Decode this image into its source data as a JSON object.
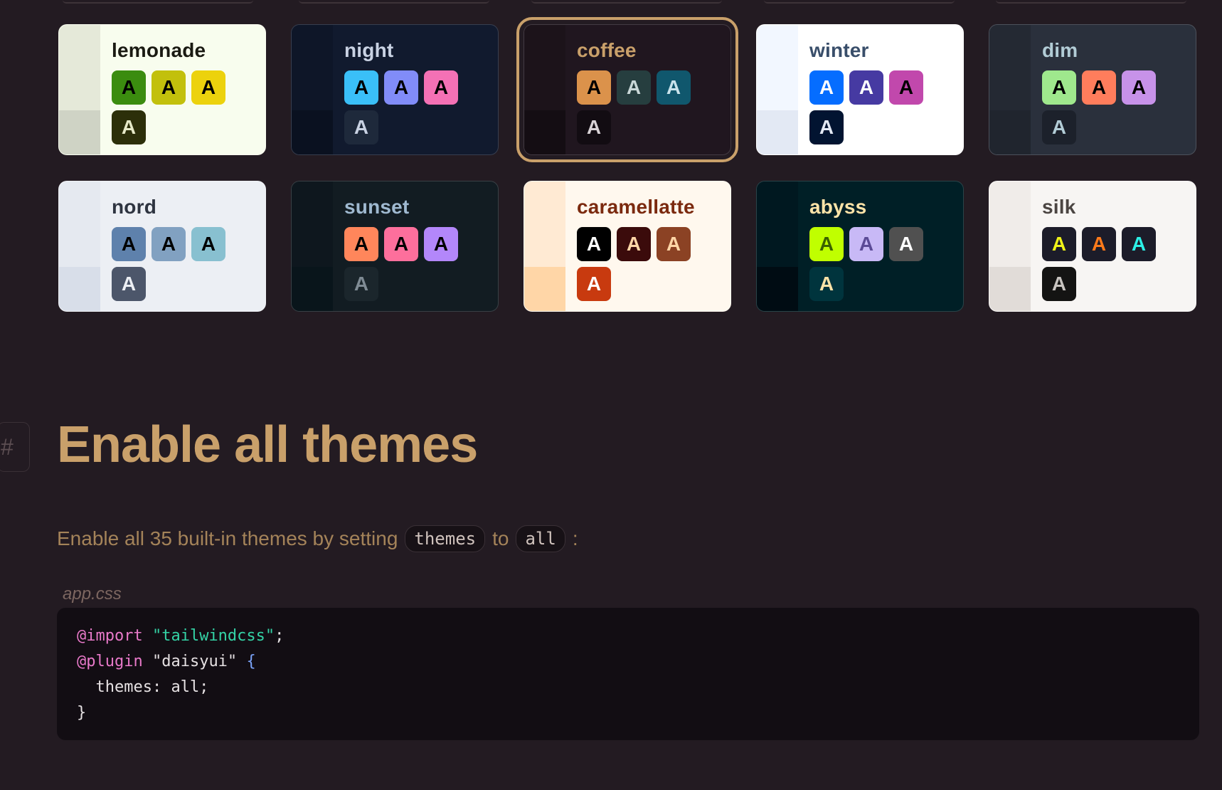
{
  "themes": [
    {
      "name": "lemonade",
      "bg": "#f8fdee",
      "side": "#e5e9d9",
      "side2": "#cfd3c5",
      "fg": "#1a1a12",
      "swatches": [
        {
          "bg": "#3b8c0f",
          "fg": "#000000"
        },
        {
          "bg": "#c2c00c",
          "fg": "#000000"
        },
        {
          "bg": "#ecd20d",
          "fg": "#000000"
        }
      ],
      "neutral": {
        "bg": "#2c2f0a",
        "fg": "#e6e9c8"
      }
    },
    {
      "name": "night",
      "bg": "#111a2e",
      "side": "#0e1628",
      "side2": "#0a1120",
      "fg": "#c9d2e3",
      "swatches": [
        {
          "bg": "#3abff8",
          "fg": "#000000"
        },
        {
          "bg": "#818cf8",
          "fg": "#000000"
        },
        {
          "bg": "#f471b5",
          "fg": "#000000"
        }
      ],
      "neutral": {
        "bg": "#1e293b",
        "fg": "#c9d2e3"
      }
    },
    {
      "name": "coffee",
      "bg": "#20161f",
      "side": "#1c131a",
      "side2": "#140d13",
      "fg": "#c9a06a",
      "swatches": [
        {
          "bg": "#db924b",
          "fg": "#000000"
        },
        {
          "bg": "#263e3f",
          "fg": "#c9d7d7"
        },
        {
          "bg": "#10576d",
          "fg": "#c9e3eb"
        }
      ],
      "neutral": {
        "bg": "#120c12",
        "fg": "#d8d2d6"
      }
    },
    {
      "name": "winter",
      "bg": "#ffffff",
      "side": "#f2f7ff",
      "side2": "#e3e9f4",
      "fg": "#394e6a",
      "swatches": [
        {
          "bg": "#056dff",
          "fg": "#ffffff"
        },
        {
          "bg": "#463aa2",
          "fg": "#ffffff"
        },
        {
          "bg": "#c148ac",
          "fg": "#000000"
        }
      ],
      "neutral": {
        "bg": "#021431",
        "fg": "#e3e9f4"
      }
    },
    {
      "name": "dim",
      "bg": "#2a303c",
      "side": "#242933",
      "side2": "#20252e",
      "fg": "#b2ccd6",
      "swatches": [
        {
          "bg": "#9fe88d",
          "fg": "#000000"
        },
        {
          "bg": "#ff7d5c",
          "fg": "#000000"
        },
        {
          "bg": "#c792e9",
          "fg": "#000000"
        }
      ],
      "neutral": {
        "bg": "#1c212b",
        "fg": "#b2ccd6"
      }
    },
    {
      "name": "nord",
      "bg": "#eceff4",
      "side": "#e5e9f0",
      "side2": "#d8dee9",
      "fg": "#2e3440",
      "swatches": [
        {
          "bg": "#5e81ac",
          "fg": "#000000"
        },
        {
          "bg": "#81a1c1",
          "fg": "#000000"
        },
        {
          "bg": "#88c0d0",
          "fg": "#000000"
        }
      ],
      "neutral": {
        "bg": "#4c566a",
        "fg": "#eceff4"
      }
    },
    {
      "name": "sunset",
      "bg": "#121c22",
      "side": "#0e171e",
      "side2": "#09151b",
      "fg": "#9fb9d0",
      "swatches": [
        {
          "bg": "#ff865b",
          "fg": "#000000"
        },
        {
          "bg": "#fd6f9c",
          "fg": "#000000"
        },
        {
          "bg": "#b387fa",
          "fg": "#000000"
        }
      ],
      "neutral": {
        "bg": "#1b262c",
        "fg": "#7f8b94"
      }
    },
    {
      "name": "caramellatte",
      "bg": "#fff8ee",
      "side": "#ffead3",
      "side2": "#ffd6a7",
      "fg": "#7b2a0f",
      "swatches": [
        {
          "bg": "#000000",
          "fg": "#ffffff"
        },
        {
          "bg": "#3b0b0b",
          "fg": "#ffd6a7"
        },
        {
          "bg": "#8b4224",
          "fg": "#ffd6a7"
        }
      ],
      "neutral": {
        "bg": "#c83a0f",
        "fg": "#ffffff"
      }
    },
    {
      "name": "abyss",
      "bg": "#001f26",
      "side": "#001820",
      "side2": "#000c13",
      "fg": "#ffe4a8",
      "swatches": [
        {
          "bg": "#c0ff00",
          "fg": "#396100"
        },
        {
          "bg": "#c8b9f6",
          "fg": "#5b4a96"
        },
        {
          "bg": "#505050",
          "fg": "#ffffff"
        }
      ],
      "neutral": {
        "bg": "#00343d",
        "fg": "#ffe4a8"
      }
    },
    {
      "name": "silk",
      "bg": "#f7f5f3",
      "side": "#f0ece9",
      "side2": "#e1dcd8",
      "fg": "#4b4542",
      "swatches": [
        {
          "bg": "#1c1c29",
          "fg": "#f0f318"
        },
        {
          "bg": "#1c1c29",
          "fg": "#ff7a1a"
        },
        {
          "bg": "#1c1c29",
          "fg": "#2cf0e6"
        }
      ],
      "neutral": {
        "bg": "#141413",
        "fg": "#c8c4c0"
      }
    }
  ],
  "active_theme": "coffee",
  "section": {
    "anchor": "#",
    "title": "Enable all themes",
    "desc_prefix": "Enable all 35 built-in themes by setting",
    "code1": "themes",
    "desc_mid": "to",
    "code2": "all",
    "desc_suffix": ":"
  },
  "code": {
    "filename": "app.css",
    "line1_kw": "@import",
    "line1_str": "\"tailwindcss\"",
    "line1_end": ";",
    "line2_kw": "@plugin",
    "line2_str": "\"daisyui\"",
    "line2_brace": "{",
    "line3": "  themes: all;",
    "line4": "}"
  }
}
